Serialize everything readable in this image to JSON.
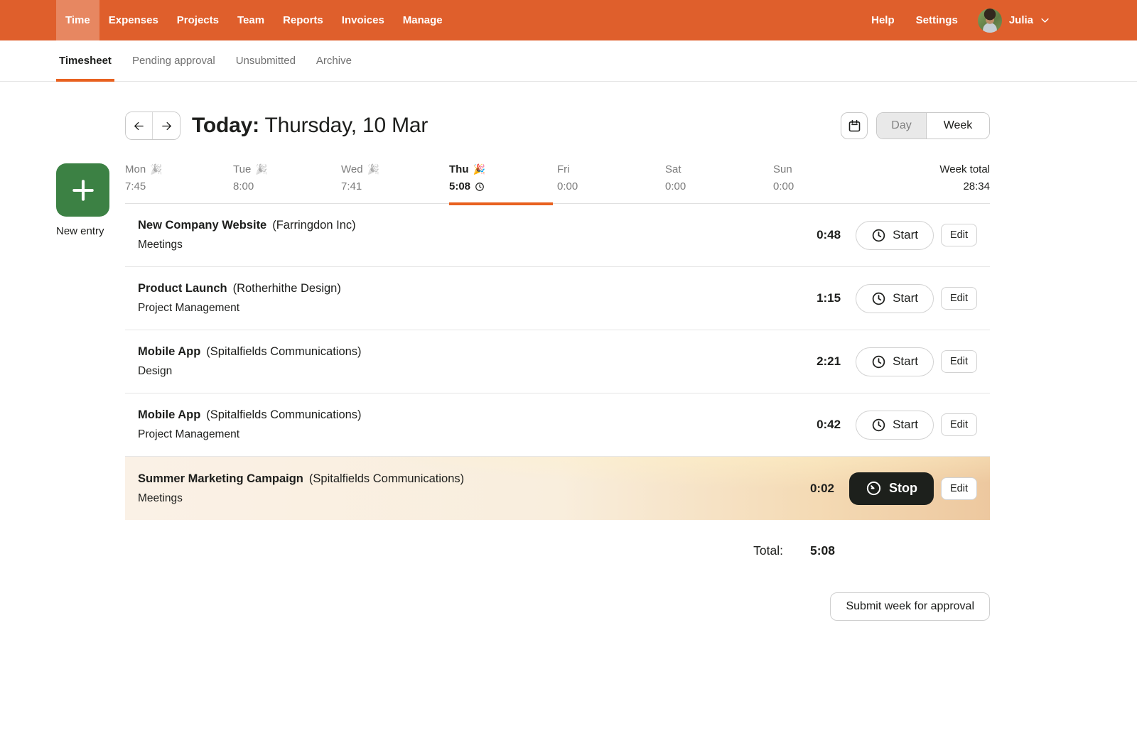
{
  "colors": {
    "nav_orange": "#DF5F2C",
    "accent_underline": "#E8611F",
    "new_entry_green": "#3C8144",
    "text_dark": "#1D1E1C",
    "running_row_left": "#FAF1E6",
    "running_row_right": "#EDC89F",
    "stop_button_bg": "#1D201C"
  },
  "nav": {
    "items": [
      {
        "label": "Time"
      },
      {
        "label": "Expenses"
      },
      {
        "label": "Projects"
      },
      {
        "label": "Team"
      },
      {
        "label": "Reports"
      },
      {
        "label": "Invoices"
      },
      {
        "label": "Manage"
      }
    ],
    "help_label": "Help",
    "settings_label": "Settings",
    "user_name": "Julia"
  },
  "tabs": [
    {
      "label": "Timesheet"
    },
    {
      "label": "Pending approval"
    },
    {
      "label": "Unsubmitted"
    },
    {
      "label": "Archive"
    }
  ],
  "date_header": {
    "prefix": "Today:",
    "date": "Thursday, 10 Mar",
    "day_label": "Day",
    "week_label": "Week"
  },
  "new_entry_label": "New entry",
  "week_strip": {
    "days": [
      {
        "label": "Mon",
        "emoji": "🎉",
        "total": "7:45"
      },
      {
        "label": "Tue",
        "emoji": "🎉",
        "total": "8:00"
      },
      {
        "label": "Wed",
        "emoji": "🎉",
        "total": "7:41"
      },
      {
        "label": "Thu",
        "emoji": "🎉",
        "total": "5:08"
      },
      {
        "label": "Fri",
        "emoji": "",
        "total": "0:00"
      },
      {
        "label": "Sat",
        "emoji": "",
        "total": "0:00"
      },
      {
        "label": "Sun",
        "emoji": "",
        "total": "0:00"
      }
    ],
    "week_total_label": "Week total",
    "week_total": "28:34"
  },
  "entries": [
    {
      "project": "New Company Website",
      "client": "(Farringdon Inc)",
      "task": "Meetings",
      "time": "0:48"
    },
    {
      "project": "Product Launch",
      "client": "(Rotherhithe Design)",
      "task": "Project Management",
      "time": "1:15"
    },
    {
      "project": "Mobile App",
      "client": "(Spitalfields Communications)",
      "task": "Design",
      "time": "2:21"
    },
    {
      "project": "Mobile App",
      "client": "(Spitalfields Communications)",
      "task": "Project Management",
      "time": "0:42"
    },
    {
      "project": "Summer Marketing Campaign",
      "client": "(Spitalfields Communications)",
      "task": "Meetings",
      "time": "0:02"
    }
  ],
  "buttons": {
    "start": "Start",
    "stop": "Stop",
    "edit": "Edit"
  },
  "totals": {
    "label": "Total:",
    "value": "5:08"
  },
  "submit_label": "Submit week for approval"
}
